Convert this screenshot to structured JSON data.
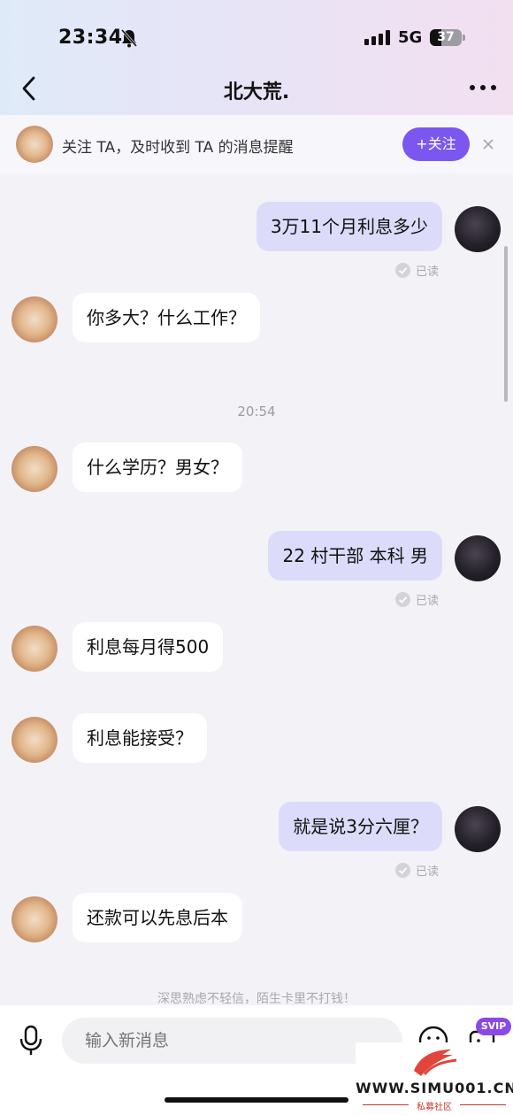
{
  "status_bar": {
    "time": "23:34",
    "network": "5G",
    "battery": "37",
    "battery_fraction": 0.37
  },
  "header": {
    "title": "北大荒."
  },
  "follow_banner": {
    "text": "关注 TA，及时收到 TA 的消息提醒",
    "button": "+关注"
  },
  "messages": [
    {
      "side": "out",
      "text": "3万11个月利息多少",
      "status": "已读"
    },
    {
      "side": "in",
      "text": "你多大？什么工作？"
    },
    {
      "type": "time",
      "text": "20:54"
    },
    {
      "side": "in",
      "text": "什么学历？男女？"
    },
    {
      "side": "out",
      "text": "22 村干部 本科 男",
      "status": "已读"
    },
    {
      "side": "in",
      "text": "利息每月得500"
    },
    {
      "side": "in",
      "text": "利息能接受？"
    },
    {
      "side": "out",
      "text": "就是说3分六厘？",
      "status": "已读"
    },
    {
      "side": "in",
      "text": "还款可以先息后本"
    }
  ],
  "disclaimer": "深思熟虑不轻信，陌生卡里不打钱！",
  "composer": {
    "placeholder": "输入新消息",
    "svip_badge": "SVIP"
  },
  "watermark": {
    "site": "WWW.SIMU001.CN",
    "sub": "私募社区"
  },
  "colors": {
    "accent": "#7b57ef",
    "outgoing_bubble": "#dcdcfa",
    "incoming_bubble": "#ffffff",
    "background": "#f3f2f7"
  },
  "icons": [
    "back-arrow-icon",
    "more-dots-icon",
    "close-icon",
    "microphone-icon",
    "emoji-icon",
    "sticker-icon",
    "read-check-icon",
    "bell-muted-icon"
  ]
}
